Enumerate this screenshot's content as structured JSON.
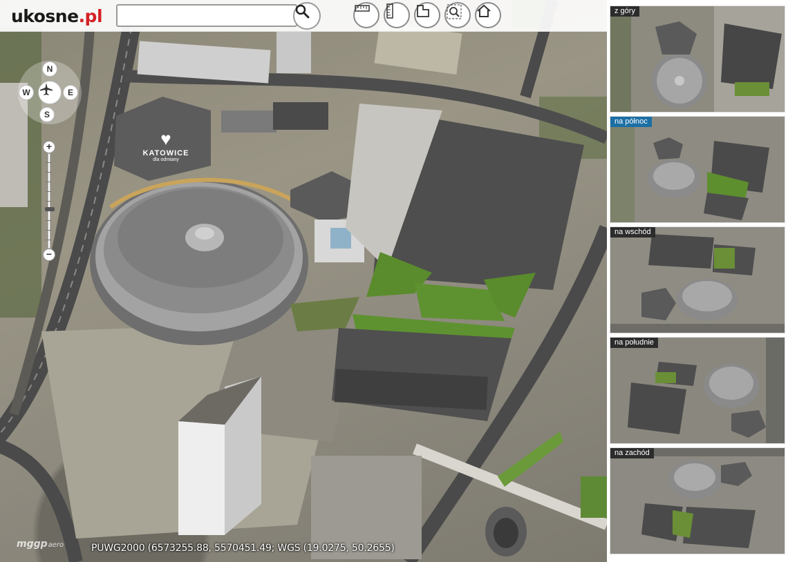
{
  "header": {
    "logo_text": "ukosne",
    "logo_suffix": ".pl",
    "search_value": "",
    "search_icon": "magnifier-icon",
    "tools": [
      {
        "name": "ruler-horizontal-icon"
      },
      {
        "name": "ruler-vertical-icon"
      },
      {
        "name": "area-measure-icon"
      },
      {
        "name": "zoom-extent-icon"
      },
      {
        "name": "home-icon"
      }
    ]
  },
  "compass": {
    "north": "N",
    "west": "W",
    "east": "E",
    "south": "S",
    "center_icon": "airplane-icon"
  },
  "zoom": {
    "in_label": "+",
    "out_label": "−",
    "level": 0.42
  },
  "map": {
    "building_sign_text": "KATOWICE",
    "building_sign_subtext": "dla odmiany",
    "coordinates_text": "PUWG2000 (6573255.88, 5570451.49; WGS (19.0275, 50.2655)",
    "watermark_text": "mggp",
    "watermark_suffix": "aero"
  },
  "views": [
    {
      "label": "z góry",
      "active": false
    },
    {
      "label": "na północ",
      "active": true
    },
    {
      "label": "na wschód",
      "active": false
    },
    {
      "label": "na południe",
      "active": false
    },
    {
      "label": "na zachód",
      "active": false
    }
  ],
  "colors": {
    "logo_accent": "#d42027",
    "active_view": "#1c6fa5",
    "label_bg": "#2c2c2c"
  }
}
